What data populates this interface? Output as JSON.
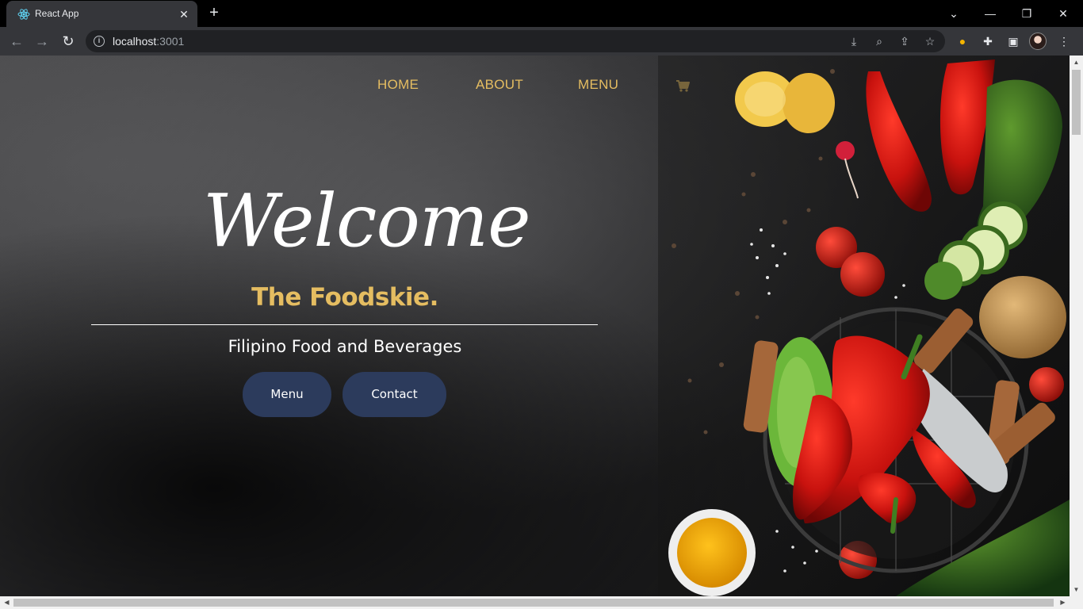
{
  "browser": {
    "tab_title": "React App",
    "tab_close": "✕",
    "new_tab": "+",
    "url_host": "localhost",
    "url_port": ":3001",
    "window_controls": {
      "dropdown": "⌄",
      "minimize": "—",
      "restore": "❐",
      "close": "✕"
    },
    "icons": [
      "back-icon",
      "forward-icon",
      "reload-icon",
      "info-icon",
      "install-icon",
      "zoom-icon",
      "share-icon",
      "star-icon",
      "extension-icon",
      "puzzle-icon",
      "sidepanel-icon",
      "menu-icon"
    ]
  },
  "site": {
    "nav": {
      "home": "HOME",
      "about": "ABOUT",
      "menu": "MENU",
      "cart_icon": "cart-icon"
    },
    "hero": {
      "welcome": "Welcome",
      "brand": "The Foodskie.",
      "tagline": "Filipino Food and Beverages",
      "menu_button": "Menu",
      "contact_button": "Contact"
    },
    "colors": {
      "accent": "#e5bd61",
      "button": "#2c3b5c",
      "text": "#ffffff"
    }
  }
}
